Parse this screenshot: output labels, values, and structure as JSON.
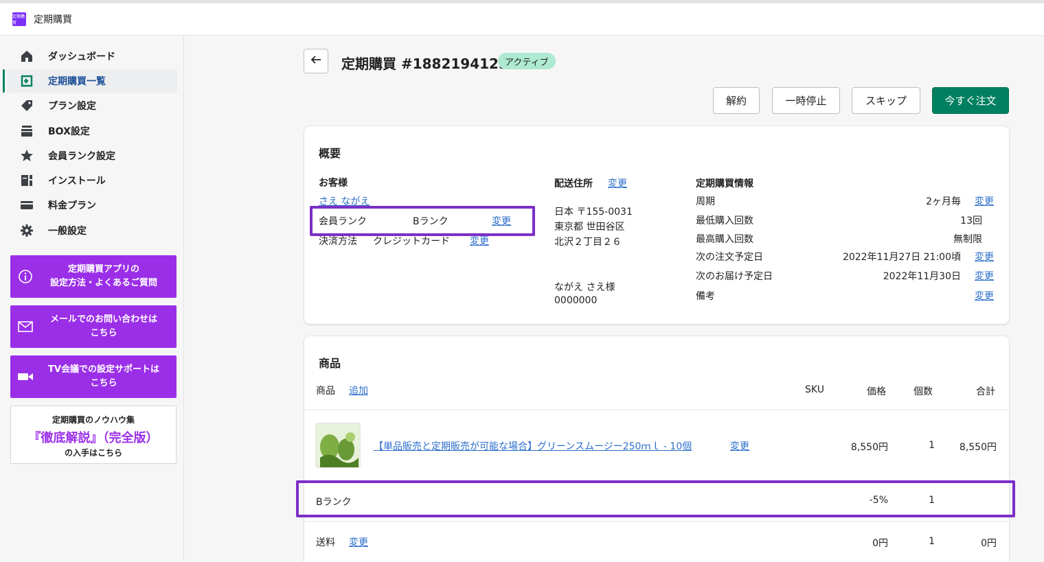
{
  "topbar": {
    "app_name": "定期購買",
    "logo_text": "定期購買"
  },
  "sidebar": {
    "items": [
      {
        "label": "ダッシュボード",
        "icon": "home-icon"
      },
      {
        "label": "定期購買一覧",
        "icon": "subscription-list-icon",
        "active": true
      },
      {
        "label": "プラン設定",
        "icon": "tag-icon"
      },
      {
        "label": "BOX設定",
        "icon": "box-icon"
      },
      {
        "label": "会員ランク設定",
        "icon": "star-icon"
      },
      {
        "label": "インストール",
        "icon": "install-icon"
      },
      {
        "label": "料金プラン",
        "icon": "card-icon"
      },
      {
        "label": "一般設定",
        "icon": "gear-icon"
      }
    ],
    "promos": [
      {
        "line1": "定期購買アプリの",
        "line2": "設定方法・よくあるご質問",
        "icon": "info-icon"
      },
      {
        "line1": "メールでのお問い合わせは",
        "line2": "こちら",
        "icon": "mail-icon"
      },
      {
        "line1": "TV会議での設定サポートは",
        "line2": "こちら",
        "icon": "video-icon"
      }
    ],
    "knowhow": {
      "line1": "定期購買のノウハウ集",
      "line2": "『徹底解説』（完全版）",
      "line3": "の入手はこちら"
    }
  },
  "header": {
    "title": "定期購買 #1882194125",
    "status": "アクティブ",
    "actions": {
      "cancel": "解約",
      "pause": "一時停止",
      "skip": "スキップ",
      "order_now": "今すぐ注文"
    }
  },
  "overview": {
    "title": "概要",
    "customer": {
      "heading": "お客様",
      "name": "さえ ながえ",
      "rank_label": "会員ランク",
      "rank_value": "Bランク",
      "rank_change": "変更",
      "payment_label": "決済方法",
      "payment_value": "クレジットカード",
      "payment_change": "変更"
    },
    "shipping": {
      "heading": "配送住所",
      "change": "変更",
      "line1": "日本 〒155-0031",
      "line2": "東京都 世田谷区",
      "line3": "北沢２丁目２６",
      "recipient": "ながえ さえ様",
      "phone": "0000000"
    },
    "info": {
      "heading": "定期購買情報",
      "rows": [
        {
          "label": "周期",
          "value": "2ヶ月毎",
          "change": "変更"
        },
        {
          "label": "最低購入回数",
          "value": "13回",
          "change": ""
        },
        {
          "label": "最高購入回数",
          "value": "無制限",
          "change": ""
        },
        {
          "label": "次の注文予定日",
          "value": "2022年11月27日 21:00頃",
          "change": "変更"
        },
        {
          "label": "次のお届け予定日",
          "value": "2022年11月30日",
          "change": "変更"
        },
        {
          "label": "備考",
          "value": "",
          "change": "変更"
        }
      ]
    }
  },
  "products": {
    "title": "商品",
    "columns": {
      "product": "商品",
      "add": "追加",
      "sku": "SKU",
      "price": "価格",
      "qty": "個数",
      "total": "合計"
    },
    "item": {
      "name": "【単品販売と定期販売が可能な場合】グリーンスムージー250ｍｌ - 10個",
      "change": "変更",
      "price": "8,550円",
      "qty": "1",
      "total": "8,550円"
    },
    "rank_row": {
      "label": "Bランク",
      "discount": "-5%",
      "qty": "1"
    },
    "shipping_row": {
      "label": "送料",
      "change": "変更",
      "price": "0円",
      "qty": "1",
      "total": "0円"
    }
  },
  "colors": {
    "accent": "#008060",
    "highlight": "#7b2fc7",
    "promo": "#9b2fe8",
    "link": "#2c6ecb"
  }
}
